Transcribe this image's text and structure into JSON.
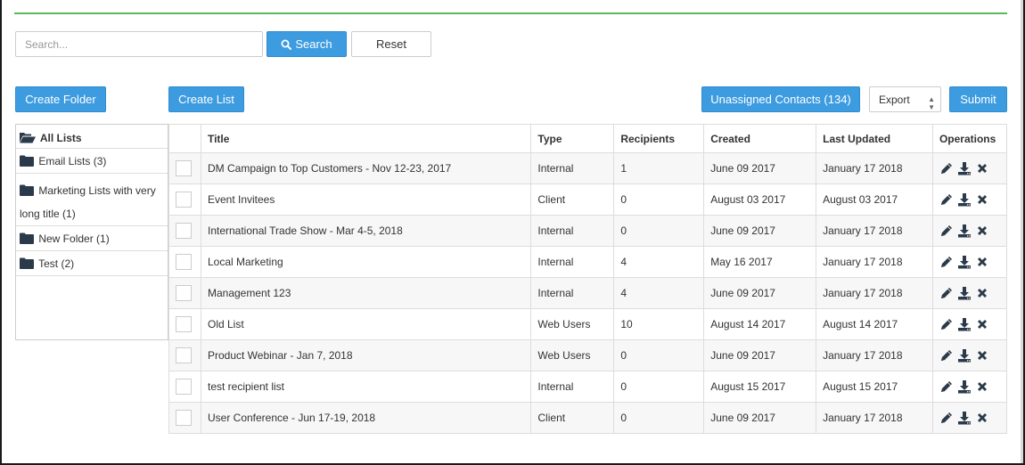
{
  "search": {
    "placeholder": "Search...",
    "button_label": "Search",
    "reset_label": "Reset"
  },
  "toolbar": {
    "create_folder": "Create Folder",
    "create_list": "Create List",
    "unassigned_contacts": "Unassigned Contacts (134)",
    "export_selected": "Export",
    "submit": "Submit"
  },
  "folders": [
    {
      "label": "All Lists",
      "icon": "folder-open-icon"
    },
    {
      "label": "Email Lists (3)",
      "icon": "folder-icon"
    },
    {
      "label": "Marketing Lists with very long title (1)",
      "icon": "folder-icon"
    },
    {
      "label": "New Folder (1)",
      "icon": "folder-icon"
    },
    {
      "label": "Test (2)",
      "icon": "folder-icon"
    }
  ],
  "table": {
    "columns": [
      "",
      "Title",
      "Type",
      "Recipients",
      "Created",
      "Last Updated",
      "Operations"
    ],
    "rows": [
      {
        "title": "DM Campaign to Top Customers - Nov 12-23, 2017",
        "type": "Internal",
        "recipients": "1",
        "created": "June 09 2017",
        "updated": "January 17 2018"
      },
      {
        "title": "Event Invitees",
        "type": "Client",
        "recipients": "0",
        "created": "August 03 2017",
        "updated": "August 03 2017"
      },
      {
        "title": "International Trade Show - Mar 4-5, 2018",
        "type": "Internal",
        "recipients": "0",
        "created": "June 09 2017",
        "updated": "January 17 2018"
      },
      {
        "title": "Local Marketing",
        "type": "Internal",
        "recipients": "4",
        "created": "May 16 2017",
        "updated": "January 17 2018"
      },
      {
        "title": "Management 123",
        "type": "Internal",
        "recipients": "4",
        "created": "June 09 2017",
        "updated": "January 17 2018"
      },
      {
        "title": "Old List",
        "type": "Web Users",
        "recipients": "10",
        "created": "August 14 2017",
        "updated": "August 14 2017"
      },
      {
        "title": "Product Webinar - Jan 7, 2018",
        "type": "Web Users",
        "recipients": "0",
        "created": "June 09 2017",
        "updated": "January 17 2018"
      },
      {
        "title": "test recipient list",
        "type": "Internal",
        "recipients": "0",
        "created": "August 15 2017",
        "updated": "August 15 2017"
      },
      {
        "title": "User Conference - Jun 17-19, 2018",
        "type": "Client",
        "recipients": "0",
        "created": "June 09 2017",
        "updated": "January 17 2018"
      }
    ],
    "operations_icons": [
      "pencil-icon",
      "download-icon",
      "delete-icon"
    ]
  },
  "colors": {
    "accent": "#3d9be0",
    "divider_green": "#5cb85c",
    "icon_dark": "#2b3a4a"
  }
}
